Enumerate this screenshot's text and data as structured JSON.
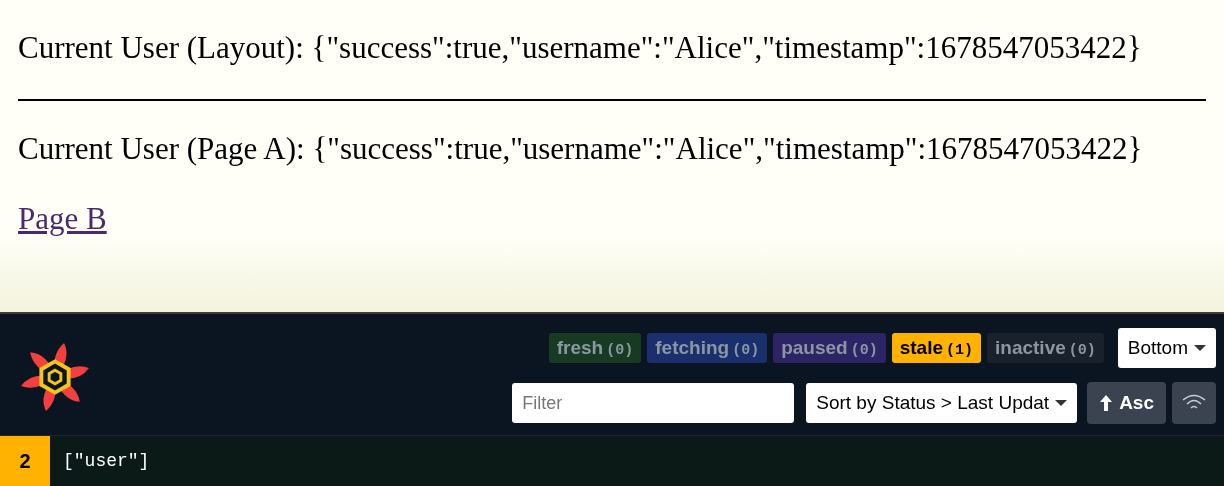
{
  "page": {
    "layout_user": "Current User (Layout): {\"success\":true,\"username\":\"Alice\",\"timestamp\":1678547053422}",
    "page_user": "Current User (Page A): {\"success\":true,\"username\":\"Alice\",\"timestamp\":1678547053422}",
    "link": "Page B"
  },
  "devtools": {
    "statuses": [
      {
        "label": "fresh",
        "count": "(0)",
        "color": "#173a22",
        "active": false
      },
      {
        "label": "fetching",
        "count": "(0)",
        "color": "#1a2f6e",
        "active": false
      },
      {
        "label": "paused",
        "count": "(0)",
        "color": "#2c2464",
        "active": false
      },
      {
        "label": "stale",
        "count": "(1)",
        "color": "#ffb200",
        "active": true
      },
      {
        "label": "inactive",
        "count": "(0)",
        "color": "#18212c",
        "active": false
      }
    ],
    "position": "Bottom",
    "filter": {
      "placeholder": "Filter"
    },
    "sort": "Sort by Status > Last Updat",
    "order": "Asc",
    "queries": [
      {
        "observers": "2",
        "key": "[\"user\"]",
        "color": "#ffb200"
      }
    ]
  }
}
